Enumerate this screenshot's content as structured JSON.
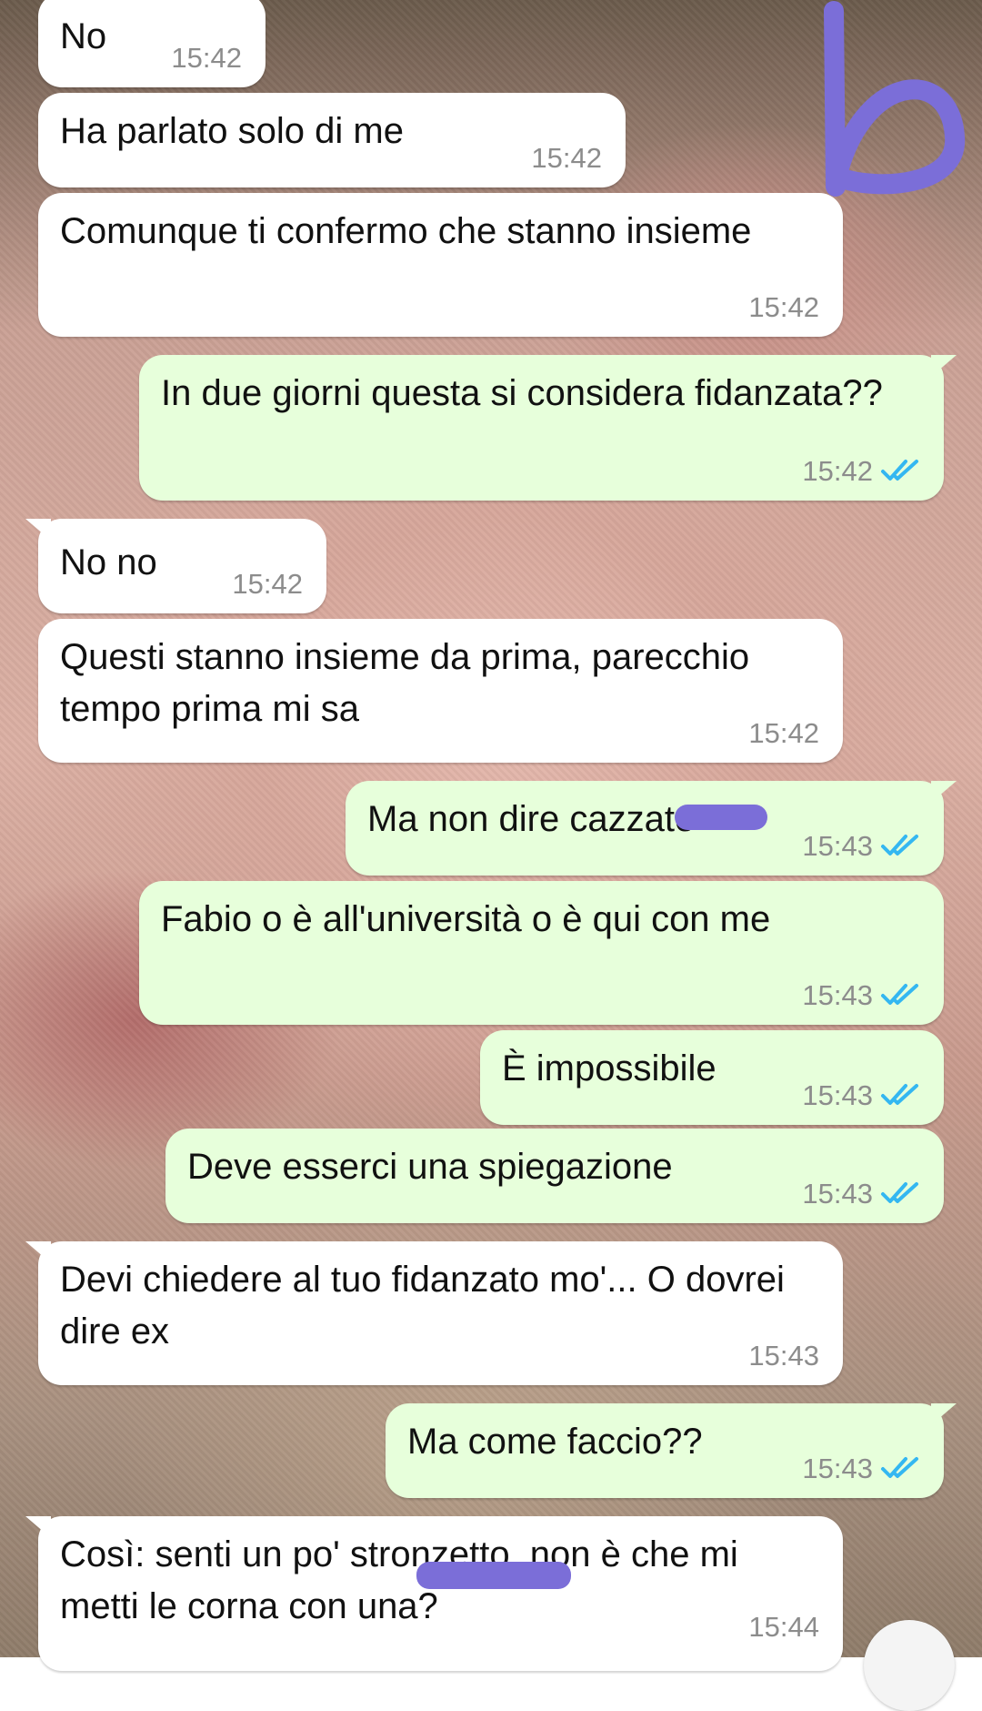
{
  "colors": {
    "incoming_bubble": "#ffffff",
    "outgoing_bubble": "#e7ffdb",
    "read_ticks": "#34b7f1",
    "annotation_ink": "#7b6ed8"
  },
  "annotation": {
    "label": "6"
  },
  "messages": [
    {
      "dir": "in",
      "text": "No",
      "time": "15:42"
    },
    {
      "dir": "in",
      "text": "Ha parlato solo di me",
      "time": "15:42"
    },
    {
      "dir": "in",
      "text": "Comunque ti confermo che stanno insieme",
      "time": "15:42"
    },
    {
      "dir": "out",
      "text": "In due giorni questa si considera fidanzata??",
      "time": "15:42",
      "status": "read"
    },
    {
      "dir": "in",
      "text": "No no",
      "time": "15:42"
    },
    {
      "dir": "in",
      "text": "Questi stanno insieme da prima, parecchio tempo prima mi sa",
      "time": "15:42"
    },
    {
      "dir": "out",
      "text": "Ma non dire cazzate",
      "time": "15:43",
      "status": "read"
    },
    {
      "dir": "out",
      "text": "Fabio o è all'università o è qui con me",
      "time": "15:43",
      "status": "read"
    },
    {
      "dir": "out",
      "text": "È impossibile",
      "time": "15:43",
      "status": "read"
    },
    {
      "dir": "out",
      "text": "Deve esserci una spiegazione",
      "time": "15:43",
      "status": "read"
    },
    {
      "dir": "in",
      "text": "Devi chiedere al tuo fidanzato mo'... O dovrei dire ex",
      "time": "15:43"
    },
    {
      "dir": "out",
      "text": "Ma come faccio??",
      "time": "15:43",
      "status": "read"
    },
    {
      "dir": "in",
      "text": "Così: senti un po' stronzetto, non è che mi metti le corna con una?",
      "time": "15:44"
    }
  ]
}
